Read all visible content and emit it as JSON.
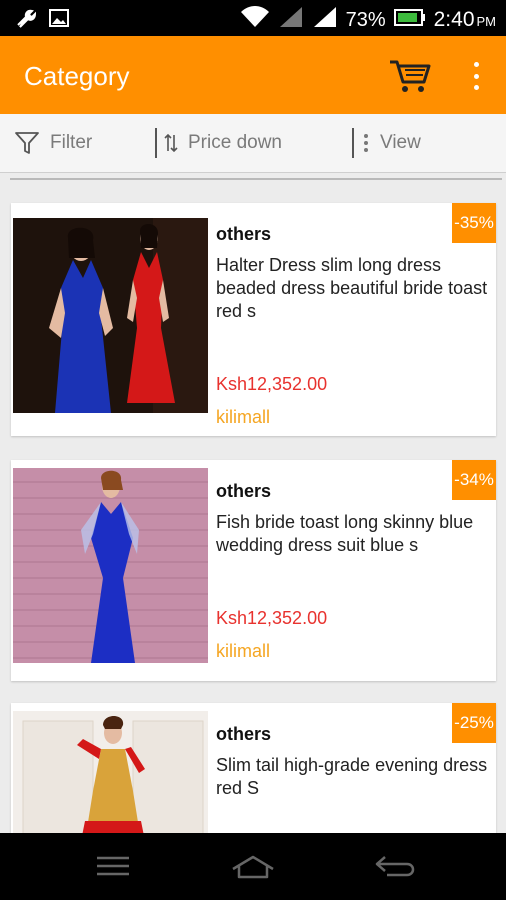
{
  "status_bar": {
    "battery_percent": "73%",
    "time": "2:40",
    "time_suffix": "PM"
  },
  "app_bar": {
    "title": "Category"
  },
  "toolbar": {
    "filter_label": "Filter",
    "sort_label": "Price down",
    "view_label": "View"
  },
  "products": [
    {
      "brand": "others",
      "name": "Halter Dress slim long dress beaded dress beautiful bride toast red s",
      "price": "Ksh12,352.00",
      "store": "kilimall",
      "discount": "-35%"
    },
    {
      "brand": "others",
      "name": "Fish bride toast long skinny blue wedding dress suit blue s",
      "price": "Ksh12,352.00",
      "store": "kilimall",
      "discount": "-34%"
    },
    {
      "brand": "others",
      "name": "Slim tail high-grade evening dress red S",
      "discount": "-25%"
    }
  ],
  "colors": {
    "accent": "#ff8f00",
    "price": "#e8322e",
    "store": "#f5a623"
  }
}
